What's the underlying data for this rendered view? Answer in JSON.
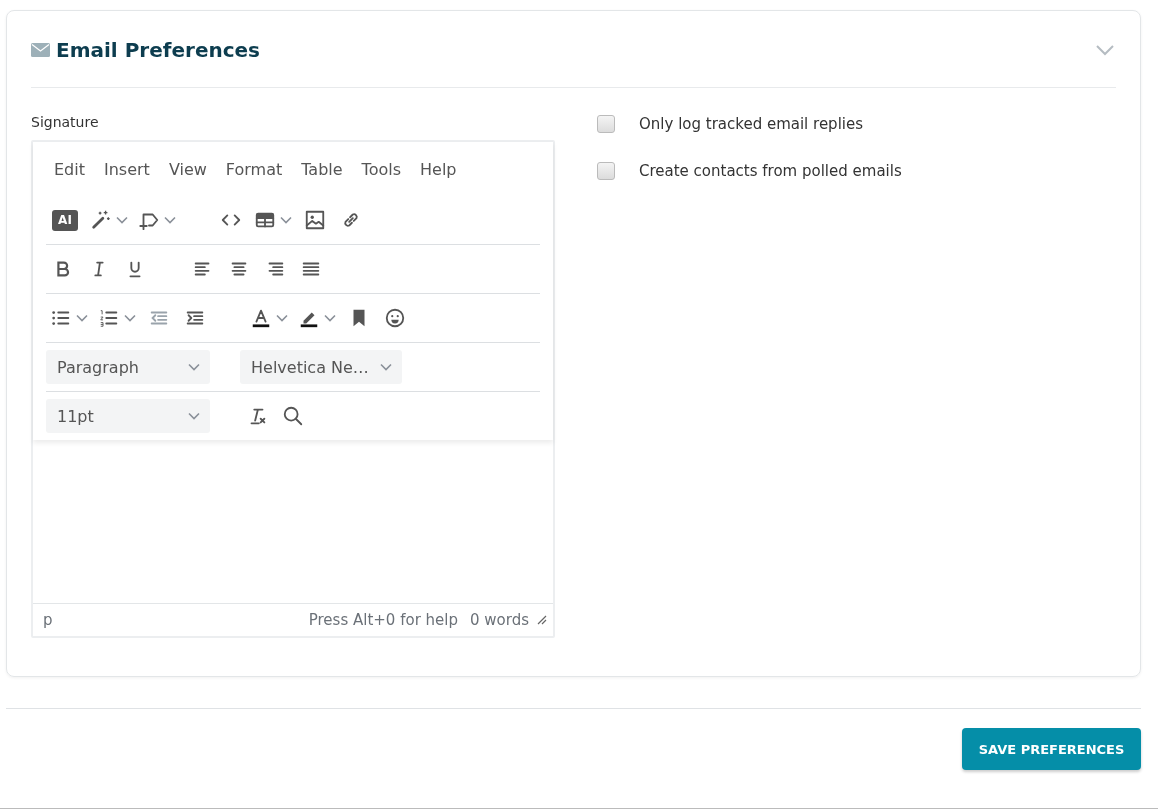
{
  "section": {
    "title": "Email Preferences",
    "expanded": true
  },
  "signature": {
    "label": "Signature",
    "menubar": [
      "Edit",
      "Insert",
      "View",
      "Format",
      "Table",
      "Tools",
      "Help"
    ],
    "ai_label": "AI",
    "block_format": "Paragraph",
    "font_family": "Helvetica Ne…",
    "font_size": "11pt",
    "status_path": "p",
    "help_text": "Press Alt+0 for help",
    "word_count": "0 words"
  },
  "options": [
    {
      "label": "Only log tracked email replies",
      "checked": false
    },
    {
      "label": "Create contacts from polled emails",
      "checked": false
    }
  ],
  "save_button": "SAVE PREFERENCES"
}
